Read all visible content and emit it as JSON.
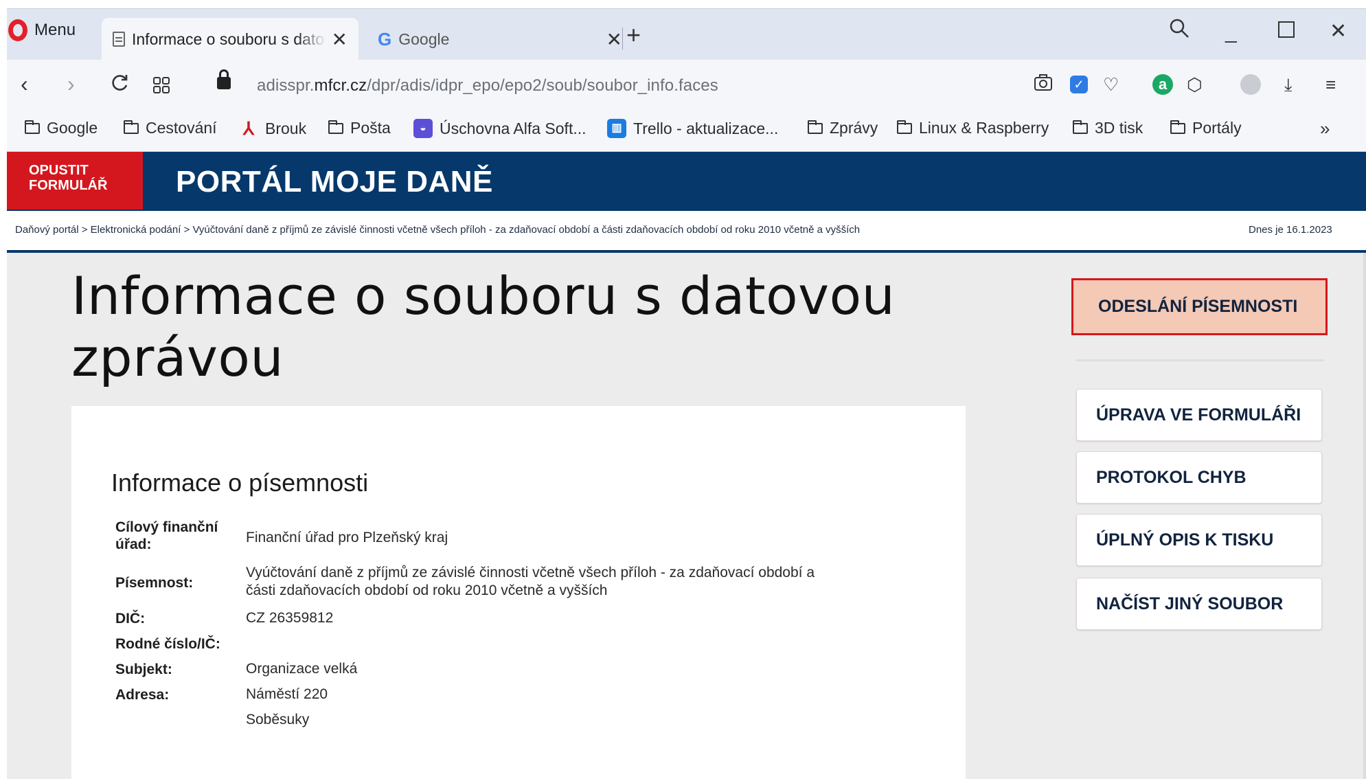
{
  "browser": {
    "menu_label": "Menu",
    "tabs": [
      {
        "title": "Informace o souboru s datovou zprávou"
      },
      {
        "title": "Google"
      }
    ],
    "url_host": "adisspr.mfcr.cz",
    "url_prefix": "adisspr.",
    "url_host_bold": "mfcr.cz",
    "url_path": "/dpr/adis/idpr_epo/epo2/soub/soubor_info.faces",
    "bookmarks": [
      {
        "label": "Google",
        "icon": "folder-icon"
      },
      {
        "label": "Cestování",
        "icon": "folder-icon"
      },
      {
        "label": "Brouk",
        "icon": "brouk-icon"
      },
      {
        "label": "Pošta",
        "icon": "folder-icon"
      },
      {
        "label": "Úschovna Alfa Soft...",
        "icon": "uschovna-icon"
      },
      {
        "label": "Trello - aktualizace...",
        "icon": "trello-icon"
      },
      {
        "label": "Zprávy",
        "icon": "folder-icon"
      },
      {
        "label": "Linux & Raspberry",
        "icon": "folder-icon"
      },
      {
        "label": "3D tisk",
        "icon": "folder-icon"
      },
      {
        "label": "Portály",
        "icon": "folder-icon"
      }
    ],
    "more_label": "»"
  },
  "portal": {
    "leave_line1": "OPUSTIT",
    "leave_line2": "FORMULÁŘ",
    "title": "PORTÁL MOJE DANĚ",
    "breadcrumb": "Daňový portál > Elektronická podání > Vyúčtování daně z příjmů ze závislé činnosti včetně všech příloh - za zdaňovací období a části zdaňovacích období od roku 2010 včetně a vyšších",
    "today": "Dnes je 16.1.2023"
  },
  "main": {
    "title_line1": "Informace o souboru s datovou",
    "title_line2": "zprávou",
    "section_heading": "Informace o písemnosti",
    "fields": {
      "office_label_1": "Cílový finanční",
      "office_label_2": "úřad:",
      "office_value": "Finanční úřad pro Plzeňský kraj",
      "document_label": "Písemnost:",
      "document_value_1": "Vyúčtování daně z příjmů ze závislé činnosti včetně všech příloh - za zdaňovací období a",
      "document_value_2": "části zdaňovacích období od roku 2010 včetně a vyšších",
      "dic_label": "DIČ:",
      "dic_value": "CZ 26359812",
      "rc_label": "Rodné číslo/IČ:",
      "rc_value": "",
      "subject_label": "Subjekt:",
      "subject_value": "Organizace velká",
      "address_label": "Adresa:",
      "address_line1": "Náměstí 220",
      "address_line2": "Soběsuky"
    }
  },
  "sidebar": {
    "primary": "ODESLÁNÍ PÍSEMNOSTI",
    "buttons": [
      "ÚPRAVA VE FORMULÁŘI",
      "PROTOKOL CHYB",
      "ÚPLNÝ OPIS K TISKU",
      "NAČÍST JINÝ SOUBOR"
    ]
  },
  "colors": {
    "header_blue": "#06386b",
    "leave_red": "#d4171e",
    "primary_fill": "#f4c9b5",
    "content_bg": "#ececec"
  }
}
